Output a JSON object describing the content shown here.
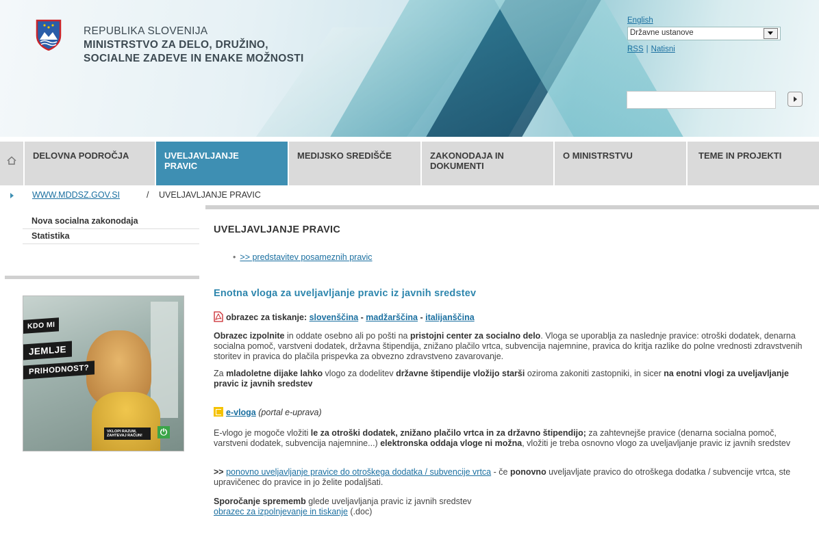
{
  "header": {
    "brand_line1": "REPUBLIKA SLOVENIJA",
    "brand_line2": "MINISTRSTVO ZA DELO, DRUŽINO,",
    "brand_line3": "SOCIALNE ZADEVE IN ENAKE MOŽNOSTI",
    "lang_link": "English",
    "institutions_select": "Državne ustanove",
    "rss_link": "RSS",
    "util_separator": "|",
    "print_link": "Natisni",
    "search_placeholder": ""
  },
  "nav": {
    "items": [
      {
        "label": "DELOVNA PODROČJA"
      },
      {
        "label": "UVELJAVLJANJE PRAVIC"
      },
      {
        "label": "MEDIJSKO SREDIŠČE"
      },
      {
        "label": "ZAKONODAJA IN DOKUMENTI"
      },
      {
        "label": "O MINISTRSTVU"
      },
      {
        "label": "TEME IN PROJEKTI"
      }
    ]
  },
  "breadcrumb": {
    "home": "WWW.MDDSZ.GOV.SI",
    "separator": "/",
    "current": "UVELJAVLJANJE PRAVIC"
  },
  "sidebar": {
    "items": [
      {
        "label": "Nova socialna zakonodaja"
      },
      {
        "label": "Statistika"
      }
    ],
    "banner": {
      "tag1": "KDO MI",
      "tag2": "JEMLJE",
      "tag3": "PRIHODNOST?",
      "small_text": "VKLOPI RAZUM, ZAHTEVAJ RAČUN!",
      "power_glyph": "⏻"
    }
  },
  "main": {
    "title": "UVELJAVLJANJE PRAVIC",
    "intro_link": ">> predstavitev posameznih pravic",
    "section_title": "Enotna vloga za uveljavljanje pravic iz javnih sredstev",
    "forms_label": "obrazec za tiskanje:",
    "form_link_sl": "slovenščina",
    "form_link_hu": "madžarščina",
    "form_link_it": "italijanščina",
    "form_sep": " - ",
    "p1": {
      "b1": "Obrazec izpolnite",
      "t1": " in oddate osebno ali po pošti na ",
      "b2": "pristojni center za socialno delo",
      "t2": ". Vloga se uporablja za naslednje pravice: otroški dodatek, denarna socialna pomoč, varstveni dodatek, državna štipendija, znižano plačilo vrtca, subvencija najemnine, pravica do kritja razlike do polne vrednosti zdravstvenih storitev in pravica do plačila prispevka za obvezno zdravstveno zavarovanje."
    },
    "p2": {
      "t1": "Za ",
      "b1": "mladoletne dijake lahko",
      "t2": " vlogo za dodelitev ",
      "b2": "državne štipendije vložijo starši",
      "t3": " oziroma zakoniti zastopniki, in sicer ",
      "b3": "na enotni vlogi za uveljavljanje pravic iz javnih sredstev"
    },
    "evloga_link": "e-vloga",
    "evloga_note": "(portal e-uprava)",
    "p3": {
      "t1": "E-vlogo je mogoče vložiti ",
      "b1": "le za otroški dodatek, znižano plačilo vrtca in za državno štipendijo;",
      "t2": " za zahtevnejše pravice (denarna socialna pomoč, varstveni dodatek, subvencija najemnine...) ",
      "b2": "elektronska oddaja vloge ni možna",
      "t3": ", vložiti je treba osnovno vlogo za uveljavljanje pravic iz javnih sredstev"
    },
    "p4": {
      "b0": ">>",
      "link": "ponovno uveljavljanje pravice do otroškega dodatka / subvencije vrtca",
      "t1": " - če ",
      "b1": "ponovno",
      "t2": " uveljavljate pravico do otroškega dodatka / subvencije vrtca, ste upravičenec do pravice in jo želite podaljšati."
    },
    "p5": {
      "b1": "Sporočanje sprememb",
      "t1": " glede uveljavljanja pravic iz javnih sredstev",
      "link": "obrazec za izpolnjevanje in tiskanje",
      "t2": " (.doc)"
    }
  },
  "colors": {
    "nav_active": "#3e8fb3",
    "nav_inactive": "#dadada",
    "link": "#1a6fa0",
    "section_title": "#2e86ad"
  }
}
